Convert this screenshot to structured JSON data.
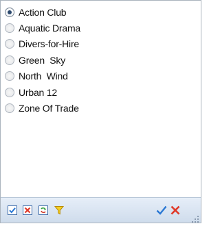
{
  "options": [
    {
      "label": "Action Club",
      "selected": true
    },
    {
      "label": "Aquatic Drama",
      "selected": false
    },
    {
      "label": "Divers-for-Hire",
      "selected": false
    },
    {
      "label": "Green  Sky",
      "selected": false
    },
    {
      "label": "North  Wind",
      "selected": false
    },
    {
      "label": "Urban 12",
      "selected": false
    },
    {
      "label": "Zone Of Trade",
      "selected": false
    }
  ],
  "toolbar": {
    "buttons": [
      "select-all-icon",
      "clear-selection-icon",
      "invert-selection-icon",
      "filter-icon",
      "ok-checkmark-icon",
      "cancel-x-icon"
    ],
    "colors": {
      "check": "#2a78d4",
      "cross": "#e03a2a",
      "filter": "#e8b400"
    }
  }
}
